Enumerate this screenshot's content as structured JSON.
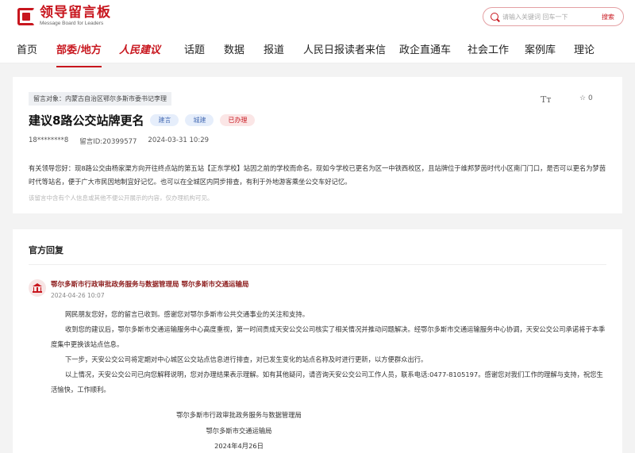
{
  "header": {
    "logo_title": "领导留言板",
    "logo_subtitle": "Message Board for Leaders",
    "search_placeholder": "请输入关键词 回车一下",
    "search_button": "搜索"
  },
  "nav": {
    "items": [
      "首页",
      "部委/地方",
      "人民建议",
      "话题",
      "数据",
      "报道",
      "人民日报读者来信",
      "政企直通车",
      "社会工作",
      "案例库",
      "理论"
    ],
    "active_index": 1
  },
  "message": {
    "target": "留言对象：内蒙古自治区鄂尔多斯市委书记李理",
    "title": "建议8路公交站牌更名",
    "tags": [
      "建言",
      "城建",
      "已办理"
    ],
    "user": "18********8",
    "message_id": "留言ID:20399577",
    "datetime": "2024-03-31 10:29",
    "font_icon_label": "Tт",
    "favorites_count": "0",
    "body": "有关领导您好：现8路公交由杨家渠方向开往终点站的第五站【正东学校】站因之前的学校而命名。现如今学校已更名为区一中铁西校区，且站牌位于维邦梦茵时代小区南门门口，是否可以更名为梦茵时代等站名，便于广大市民因地制宜好记忆。也可以在全城区内同步排查，有利于外地游客乘坐公交车好记忆。",
    "note": "该留言中含有个人信息或其他不便公开展示的内容，仅办理机构可见。"
  },
  "reply": {
    "heading": "官方回复",
    "department": "鄂尔多斯市行政审批政务服务与数据管理局 鄂尔多斯市交通运输局",
    "date": "2024-04-26 10:07",
    "paragraphs": [
      "网民朋友您好，您的留言已收到。感谢您对鄂尔多斯市公共交通事业的关注和支持。",
      "收到您的建议后，鄂尔多斯市交通运输服务中心高度重视，第一时间责成天安公交公司核实了相关情况并推动问题解决。经鄂尔多斯市交通运输服务中心协调，天安公交公司承诺将于本季度集中更换该站点信息。",
      "下一步，天安公交公司将定期对中心城区公交站点信息进行排查，对已发生变化的站点名称及时进行更新，以方便群众出行。",
      "以上情况，天安公交公司已向您解释说明，您对办理结果表示理解。如有其他疑问，请咨询天安公交公司工作人员，联系电话:0477-8105197。感谢您对我们工作的理解与支持，祝您生活愉快，工作顺利。"
    ],
    "signature_1": "鄂尔多斯市行政审批政务服务与数据管理局",
    "signature_2": "鄂尔多斯市交通运输局",
    "signature_date": "2024年4月26日"
  },
  "colors": {
    "brand_red": "#c8161e",
    "tag_blue": "#4a6fb5"
  }
}
